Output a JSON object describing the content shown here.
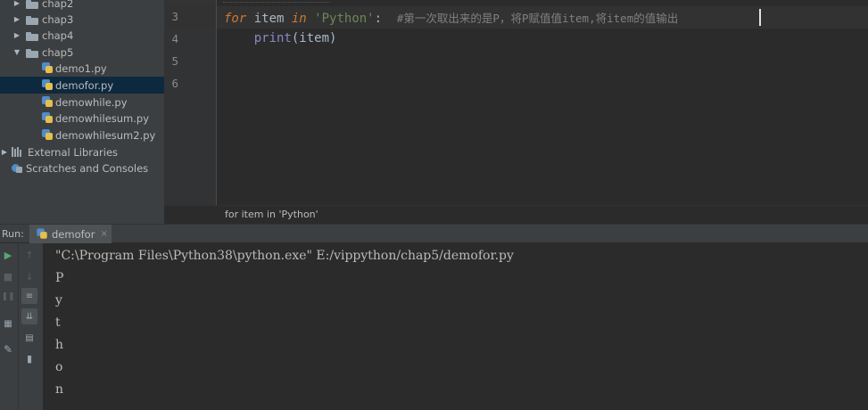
{
  "project_tree": {
    "items": [
      {
        "label": "chap2",
        "kind": "folder",
        "expanded": false
      },
      {
        "label": "chap3",
        "kind": "folder",
        "expanded": false
      },
      {
        "label": "chap4",
        "kind": "folder",
        "expanded": false
      },
      {
        "label": "chap5",
        "kind": "folder",
        "expanded": true
      },
      {
        "label": "demo1.py",
        "kind": "file"
      },
      {
        "label": "demofor.py",
        "kind": "file",
        "selected": true
      },
      {
        "label": "demowhile.py",
        "kind": "file"
      },
      {
        "label": "demowhilesum.py",
        "kind": "file"
      },
      {
        "label": "demowhilesum2.py",
        "kind": "file"
      },
      {
        "label": "External Libraries",
        "kind": "libraries"
      },
      {
        "label": "Scratches and Consoles",
        "kind": "scratches"
      }
    ]
  },
  "editor": {
    "line_numbers": [
      "3",
      "4",
      "5",
      "6"
    ],
    "line3": {
      "kw_for": "for",
      "var": " item ",
      "kw_in": "in",
      "string": "'Python'",
      "colon": ":",
      "comment": "#第一次取出来的是P，将P赋值值item,将item的值输出"
    },
    "line4": {
      "indent": "    ",
      "func": "print",
      "args": "(item)"
    },
    "breadcrumb": "for item in 'Python'"
  },
  "run_panel": {
    "label": "Run:",
    "tab_label": "demofor",
    "tab_close": "×",
    "console_lines": [
      "\"C:\\Program Files\\Python38\\python.exe\" E:/vippython/chap5/demofor.py",
      "P",
      "y",
      "t",
      "h",
      "o",
      "n"
    ],
    "toolbar": [
      {
        "icon": "run-icon"
      },
      {
        "icon": "stop-icon"
      },
      {
        "icon": "pause-icon"
      },
      {
        "icon": "layout-icon"
      },
      {
        "icon": "pin-icon"
      },
      {
        "icon": "up-arrow-icon"
      },
      {
        "icon": "down-arrow-icon"
      },
      {
        "icon": "soft-wrap-icon"
      },
      {
        "icon": "scroll-to-end-icon"
      },
      {
        "icon": "print-icon"
      },
      {
        "icon": "trash-icon"
      }
    ]
  },
  "colors": {
    "keyword": "#cc7832",
    "string": "#6a8759",
    "comment": "#808080",
    "builtin": "#8888c6",
    "selection": "#0d293e"
  }
}
